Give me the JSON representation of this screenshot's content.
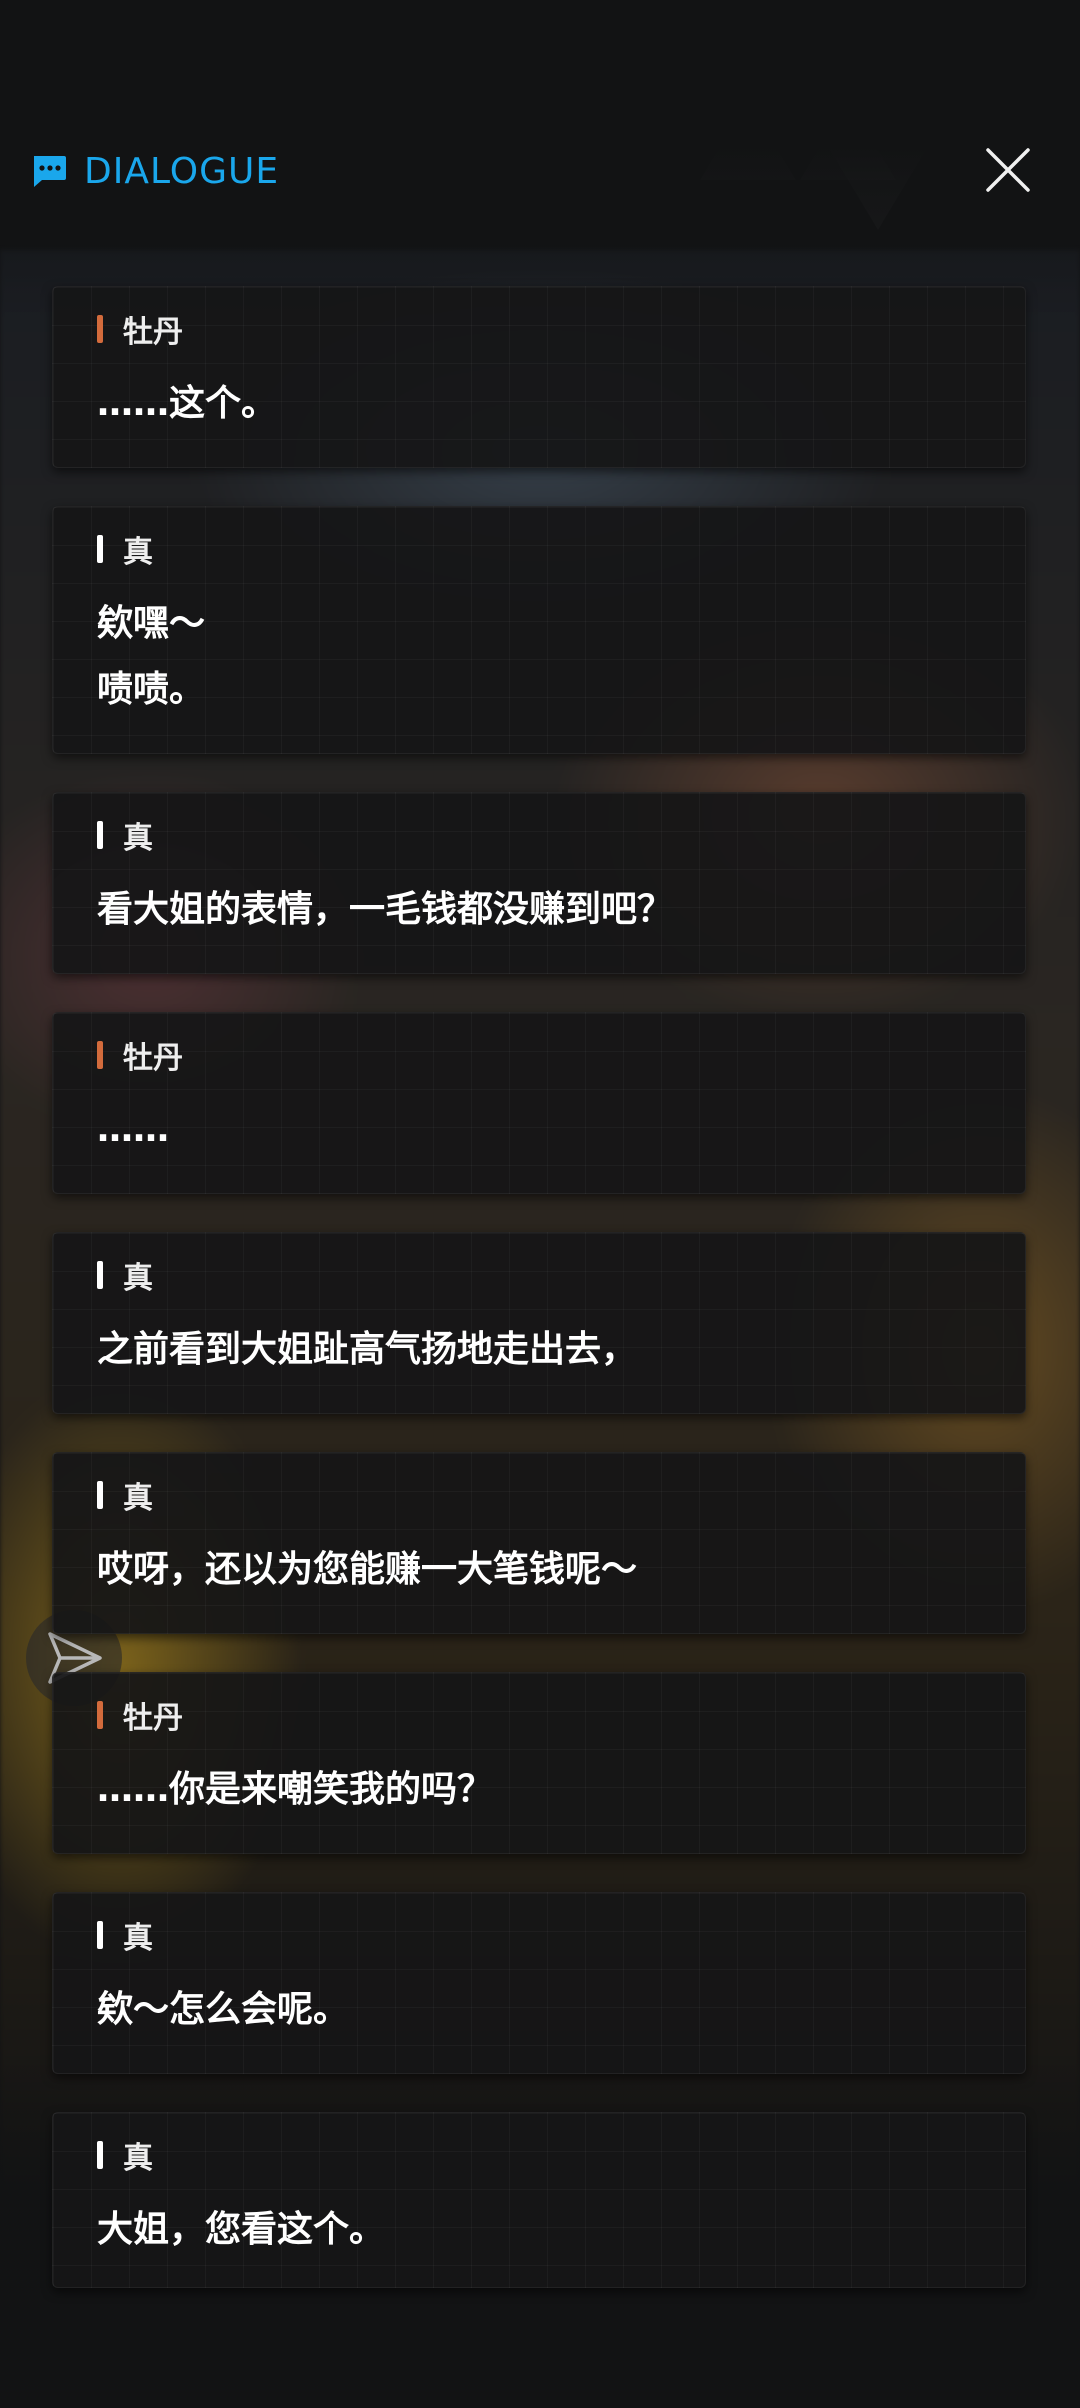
{
  "header": {
    "title": "DIALOGUE",
    "chat_icon": "chat-bubble-icon",
    "close_icon": "close-icon",
    "accent_color": "#1aa7ec"
  },
  "colors": {
    "speaker_bar_peony": "#d36b3c",
    "speaker_bar_zhen": "#ffffff"
  },
  "dialogue": [
    {
      "speaker": "牡丹",
      "bar": "orange",
      "lines": [
        "……这个。"
      ]
    },
    {
      "speaker": "真",
      "bar": "white",
      "lines": [
        "欸嘿～",
        "啧啧。"
      ]
    },
    {
      "speaker": "真",
      "bar": "white",
      "lines": [
        "看大姐的表情，一毛钱都没赚到吧？"
      ]
    },
    {
      "speaker": "牡丹",
      "bar": "orange",
      "lines": [
        "……"
      ]
    },
    {
      "speaker": "真",
      "bar": "white",
      "lines": [
        "之前看到大姐趾高气扬地走出去，"
      ]
    },
    {
      "speaker": "真",
      "bar": "white",
      "lines": [
        "哎呀，还以为您能赚一大笔钱呢～"
      ]
    },
    {
      "speaker": "牡丹",
      "bar": "orange",
      "lines": [
        "……你是来嘲笑我的吗？"
      ]
    },
    {
      "speaker": "真",
      "bar": "white",
      "lines": [
        "欸～怎么会呢。"
      ]
    },
    {
      "speaker": "真",
      "bar": "white",
      "lines": [
        "大姐，您看这个。"
      ]
    }
  ],
  "send_icon": "send-icon"
}
